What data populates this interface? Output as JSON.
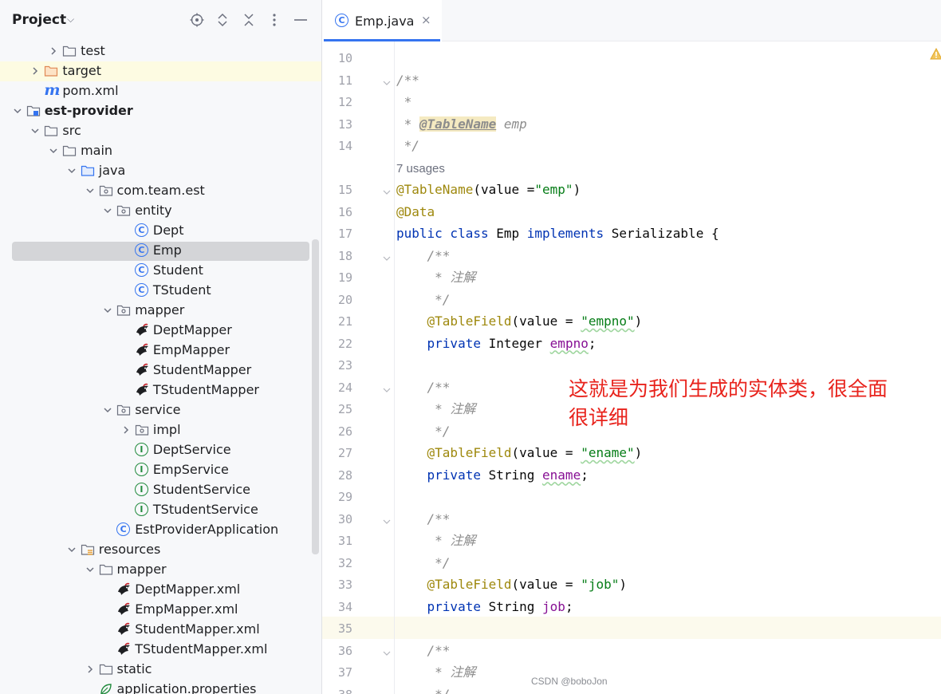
{
  "project_panel": {
    "title": "Project",
    "tree": [
      {
        "label": "test",
        "type": "folder",
        "depth": 3,
        "arrow": "right"
      },
      {
        "label": "target",
        "type": "folder-orange",
        "depth": 2,
        "arrow": "right",
        "highlight": true
      },
      {
        "label": "pom.xml",
        "type": "maven",
        "depth": 2,
        "arrow": "none"
      },
      {
        "label": "est-provider",
        "type": "module",
        "depth": 1,
        "arrow": "down",
        "bold": true
      },
      {
        "label": "src",
        "type": "folder",
        "depth": 2,
        "arrow": "down"
      },
      {
        "label": "main",
        "type": "folder",
        "depth": 3,
        "arrow": "down"
      },
      {
        "label": "java",
        "type": "folder-blue",
        "depth": 4,
        "arrow": "down"
      },
      {
        "label": "com.team.est",
        "type": "package",
        "depth": 5,
        "arrow": "down"
      },
      {
        "label": "entity",
        "type": "package",
        "depth": 6,
        "arrow": "down"
      },
      {
        "label": "Dept",
        "type": "class",
        "depth": 7,
        "arrow": "none"
      },
      {
        "label": "Emp",
        "type": "class",
        "depth": 7,
        "arrow": "none",
        "selected": true
      },
      {
        "label": "Student",
        "type": "class",
        "depth": 7,
        "arrow": "none"
      },
      {
        "label": "TStudent",
        "type": "class",
        "depth": 7,
        "arrow": "none"
      },
      {
        "label": "mapper",
        "type": "package",
        "depth": 6,
        "arrow": "down"
      },
      {
        "label": "DeptMapper",
        "type": "mybatis",
        "depth": 7,
        "arrow": "none"
      },
      {
        "label": "EmpMapper",
        "type": "mybatis",
        "depth": 7,
        "arrow": "none"
      },
      {
        "label": "StudentMapper",
        "type": "mybatis",
        "depth": 7,
        "arrow": "none"
      },
      {
        "label": "TStudentMapper",
        "type": "mybatis",
        "depth": 7,
        "arrow": "none"
      },
      {
        "label": "service",
        "type": "package",
        "depth": 6,
        "arrow": "down"
      },
      {
        "label": "impl",
        "type": "package",
        "depth": 7,
        "arrow": "right"
      },
      {
        "label": "DeptService",
        "type": "interface",
        "depth": 7,
        "arrow": "none"
      },
      {
        "label": "EmpService",
        "type": "interface",
        "depth": 7,
        "arrow": "none"
      },
      {
        "label": "StudentService",
        "type": "interface",
        "depth": 7,
        "arrow": "none"
      },
      {
        "label": "TStudentService",
        "type": "interface",
        "depth": 7,
        "arrow": "none"
      },
      {
        "label": "EstProviderApplication",
        "type": "spring-class",
        "depth": 6,
        "arrow": "none"
      },
      {
        "label": "resources",
        "type": "resources",
        "depth": 4,
        "arrow": "down"
      },
      {
        "label": "mapper",
        "type": "folder",
        "depth": 5,
        "arrow": "down"
      },
      {
        "label": "DeptMapper.xml",
        "type": "mybatis",
        "depth": 6,
        "arrow": "none"
      },
      {
        "label": "EmpMapper.xml",
        "type": "mybatis",
        "depth": 6,
        "arrow": "none"
      },
      {
        "label": "StudentMapper.xml",
        "type": "mybatis",
        "depth": 6,
        "arrow": "none"
      },
      {
        "label": "TStudentMapper.xml",
        "type": "mybatis",
        "depth": 6,
        "arrow": "none"
      },
      {
        "label": "static",
        "type": "folder",
        "depth": 5,
        "arrow": "right"
      },
      {
        "label": "application.properties",
        "type": "properties",
        "depth": 5,
        "arrow": "none"
      }
    ]
  },
  "editor": {
    "tab": {
      "label": "Emp.java",
      "close": "×"
    },
    "lines": [
      {
        "n": "10",
        "fold": false,
        "segs": []
      },
      {
        "n": "11",
        "fold": true,
        "segs": [
          {
            "t": "/**",
            "c": "c-doc"
          }
        ]
      },
      {
        "n": "12",
        "fold": false,
        "segs": [
          {
            "t": " *",
            "c": "c-doc"
          }
        ]
      },
      {
        "n": "13",
        "fold": false,
        "segs": [
          {
            "t": " * ",
            "c": "c-doc"
          },
          {
            "t": "@TableName",
            "c": "c-tag"
          },
          {
            "t": " emp",
            "c": "c-doc"
          }
        ]
      },
      {
        "n": "14",
        "fold": false,
        "segs": [
          {
            "t": " */",
            "c": "c-doc"
          }
        ]
      },
      {
        "inlay": "7 usages"
      },
      {
        "n": "15",
        "fold": true,
        "segs": [
          {
            "t": "@TableName",
            "c": "c-ann"
          },
          {
            "t": "(value =",
            "c": ""
          },
          {
            "t": "\"emp\"",
            "c": "c-str"
          },
          {
            "t": ")",
            "c": ""
          }
        ]
      },
      {
        "n": "16",
        "fold": false,
        "segs": [
          {
            "t": "@Data",
            "c": "c-ann"
          }
        ]
      },
      {
        "n": "17",
        "fold": false,
        "segs": [
          {
            "t": "public class",
            "c": "c-kw"
          },
          {
            "t": " Emp ",
            "c": ""
          },
          {
            "t": "implements",
            "c": "c-kw"
          },
          {
            "t": " Serializable {",
            "c": ""
          }
        ]
      },
      {
        "n": "18",
        "fold": true,
        "segs": [
          {
            "t": "    /**",
            "c": "c-doc"
          }
        ]
      },
      {
        "n": "19",
        "fold": false,
        "segs": [
          {
            "t": "     * 注解",
            "c": "c-doc"
          }
        ]
      },
      {
        "n": "20",
        "fold": false,
        "segs": [
          {
            "t": "     */",
            "c": "c-doc"
          }
        ]
      },
      {
        "n": "21",
        "fold": false,
        "segs": [
          {
            "t": "    @TableField",
            "c": "c-ann"
          },
          {
            "t": "(value = ",
            "c": ""
          },
          {
            "t": "\"empno\"",
            "c": "c-str c-wavy"
          },
          {
            "t": ")",
            "c": ""
          }
        ]
      },
      {
        "n": "22",
        "fold": false,
        "segs": [
          {
            "t": "    private",
            "c": "c-kw"
          },
          {
            "t": " Integer ",
            "c": ""
          },
          {
            "t": "empno",
            "c": "c-fld c-wavy"
          },
          {
            "t": ";",
            "c": ""
          }
        ]
      },
      {
        "n": "23",
        "fold": false,
        "segs": []
      },
      {
        "n": "24",
        "fold": true,
        "segs": [
          {
            "t": "    /**",
            "c": "c-doc"
          }
        ]
      },
      {
        "n": "25",
        "fold": false,
        "segs": [
          {
            "t": "     * 注解",
            "c": "c-doc"
          }
        ]
      },
      {
        "n": "26",
        "fold": false,
        "segs": [
          {
            "t": "     */",
            "c": "c-doc"
          }
        ]
      },
      {
        "n": "27",
        "fold": false,
        "segs": [
          {
            "t": "    @TableField",
            "c": "c-ann"
          },
          {
            "t": "(value = ",
            "c": ""
          },
          {
            "t": "\"ename\"",
            "c": "c-str c-wavy"
          },
          {
            "t": ")",
            "c": ""
          }
        ]
      },
      {
        "n": "28",
        "fold": false,
        "segs": [
          {
            "t": "    private",
            "c": "c-kw"
          },
          {
            "t": " String ",
            "c": ""
          },
          {
            "t": "ename",
            "c": "c-fld c-wavy"
          },
          {
            "t": ";",
            "c": ""
          }
        ]
      },
      {
        "n": "29",
        "fold": false,
        "segs": []
      },
      {
        "n": "30",
        "fold": true,
        "segs": [
          {
            "t": "    /**",
            "c": "c-doc"
          }
        ]
      },
      {
        "n": "31",
        "fold": false,
        "segs": [
          {
            "t": "     * 注解",
            "c": "c-doc"
          }
        ]
      },
      {
        "n": "32",
        "fold": false,
        "segs": [
          {
            "t": "     */",
            "c": "c-doc"
          }
        ]
      },
      {
        "n": "33",
        "fold": false,
        "segs": [
          {
            "t": "    @TableField",
            "c": "c-ann"
          },
          {
            "t": "(value = ",
            "c": ""
          },
          {
            "t": "\"job\"",
            "c": "c-str"
          },
          {
            "t": ")",
            "c": ""
          }
        ]
      },
      {
        "n": "34",
        "fold": false,
        "segs": [
          {
            "t": "    private",
            "c": "c-kw"
          },
          {
            "t": " String ",
            "c": ""
          },
          {
            "t": "job",
            "c": "c-fld"
          },
          {
            "t": ";",
            "c": ""
          }
        ]
      },
      {
        "n": "35",
        "fold": false,
        "segs": [],
        "current": true
      },
      {
        "n": "36",
        "fold": true,
        "segs": [
          {
            "t": "    /**",
            "c": "c-doc"
          }
        ]
      },
      {
        "n": "37",
        "fold": false,
        "segs": [
          {
            "t": "     * 注解",
            "c": "c-doc"
          }
        ]
      },
      {
        "n": "38",
        "fold": false,
        "segs": [
          {
            "t": "     */",
            "c": "c-doc"
          }
        ]
      }
    ]
  },
  "annotation": {
    "line1": "这就是为我们生成的实体类，很全面",
    "line2": "很详细"
  },
  "watermark": "CSDN @boboJon",
  "colors": {
    "accent": "#3574f0",
    "annotation_red": "#e8231c",
    "selection": "#d4d5d8",
    "current_line": "#fcfaed"
  }
}
